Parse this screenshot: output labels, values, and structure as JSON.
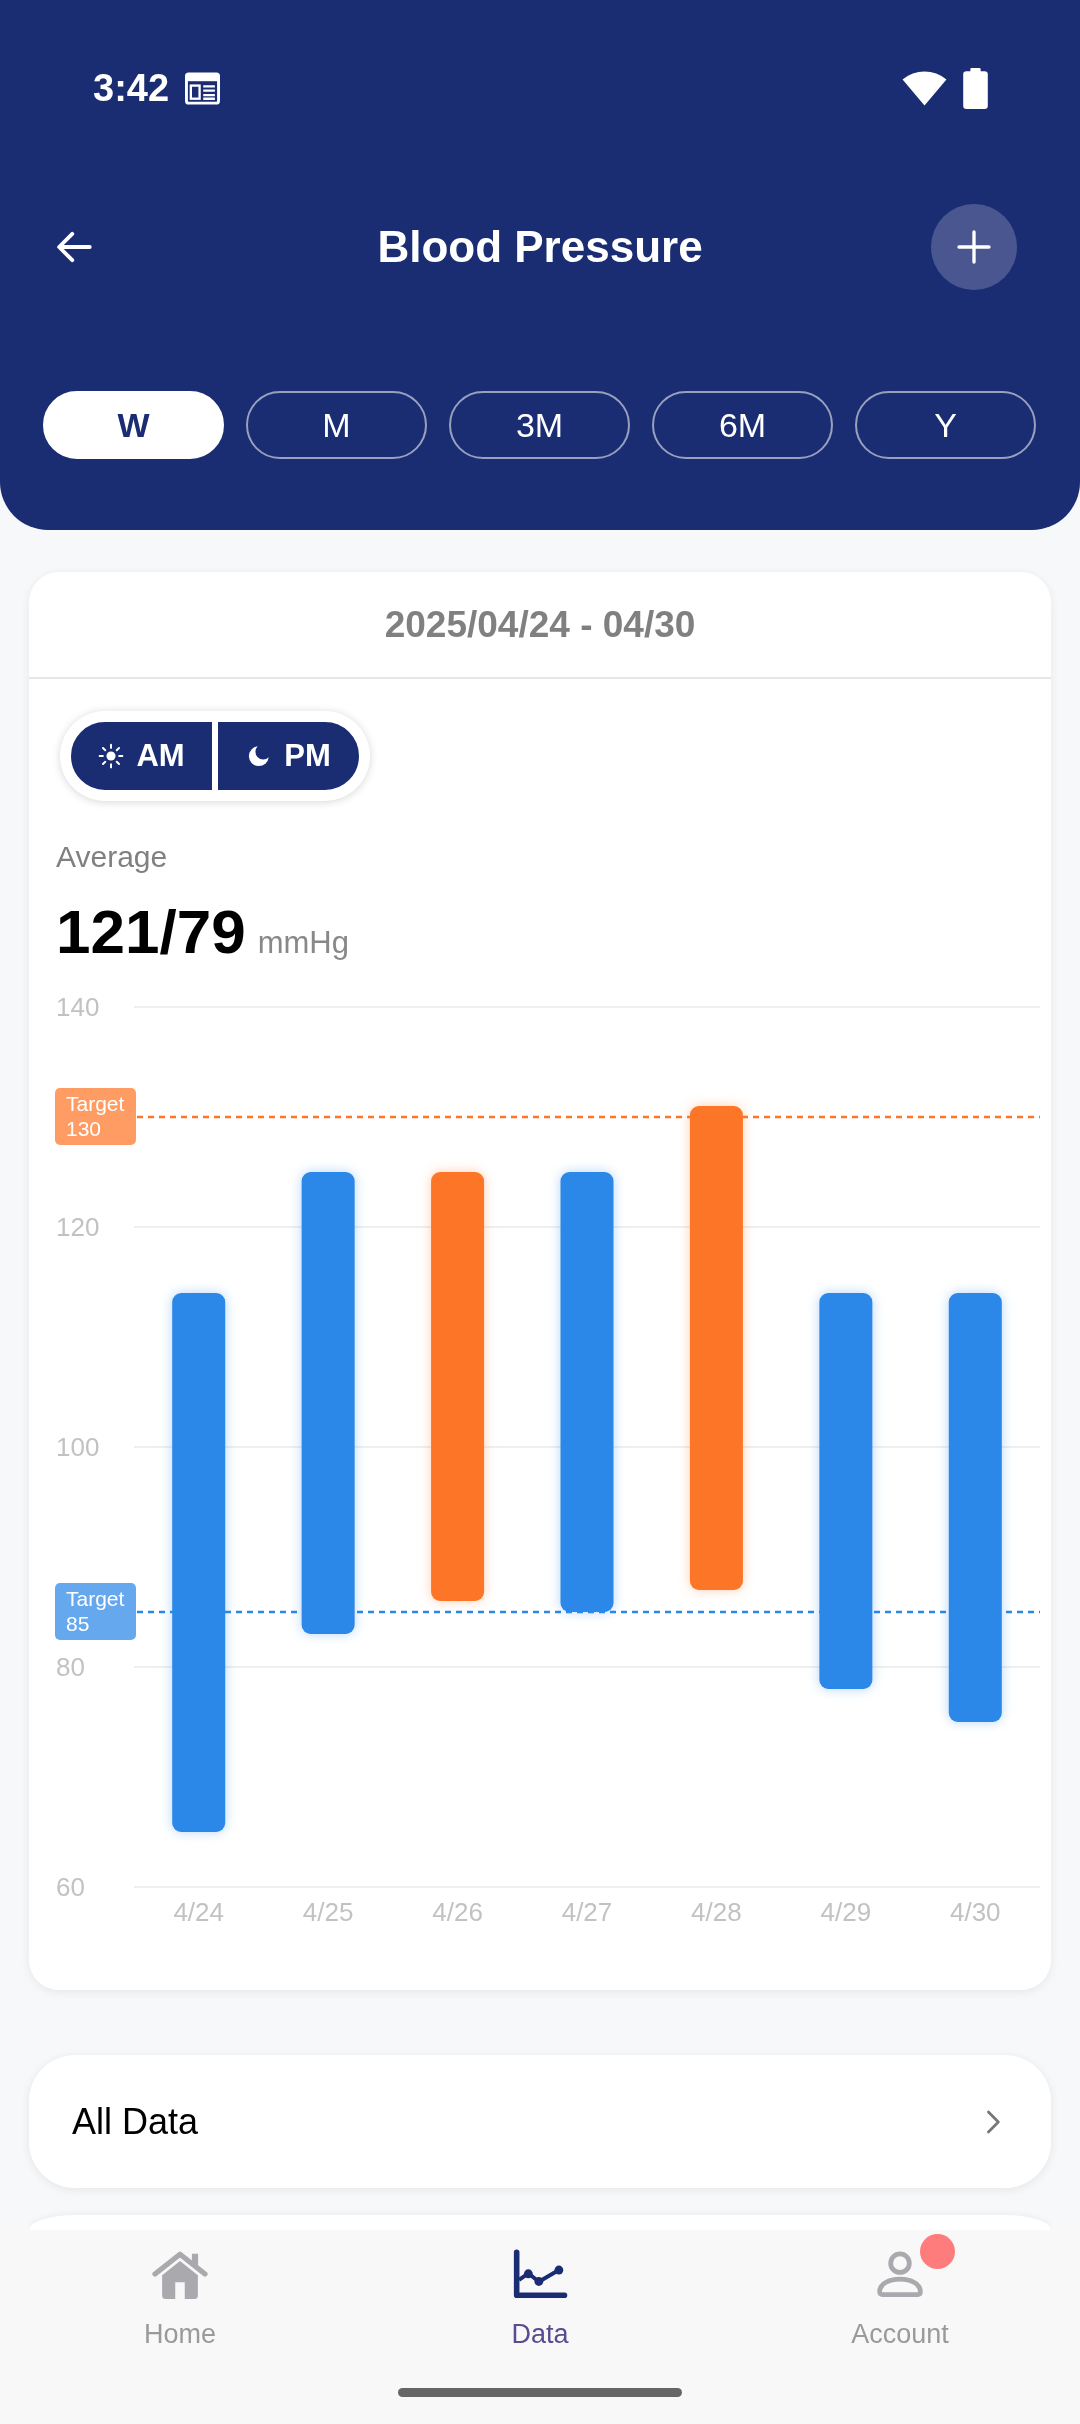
{
  "status_bar": {
    "time": "3:42"
  },
  "header": {
    "title": "Blood Pressure"
  },
  "range_tabs": [
    {
      "label": "W",
      "selected": true
    },
    {
      "label": "M",
      "selected": false
    },
    {
      "label": "3M",
      "selected": false
    },
    {
      "label": "6M",
      "selected": false
    },
    {
      "label": "Y",
      "selected": false
    }
  ],
  "summary_card": {
    "date_range": "2025/04/24 - 04/30",
    "session_toggle": [
      {
        "label": "AM",
        "on": true
      },
      {
        "label": "PM",
        "on": true
      }
    ],
    "average": {
      "label": "Average",
      "value": "121/79",
      "unit": "mmHg"
    },
    "chart_data": {
      "type": "candlestick",
      "categories": [
        "4/24",
        "4/25",
        "4/26",
        "4/27",
        "4/28",
        "4/29",
        "4/30"
      ],
      "series": [
        {
          "color": "#2b87e8",
          "ohlc": [
            [
              65,
              114,
              65,
              114
            ],
            [
              83,
              125,
              83,
              125
            ],
            null,
            [
              85,
              125,
              85,
              125
            ],
            null,
            [
              78,
              114,
              78,
              114
            ],
            [
              75,
              114,
              75,
              114
            ]
          ]
        },
        {
          "color": "#fd7628",
          "ohlc": [
            null,
            null,
            [
              86,
              125,
              86,
              125
            ],
            null,
            [
              87,
              131,
              87,
              131
            ],
            null,
            null
          ]
        }
      ],
      "ylim": [
        60,
        140
      ],
      "yticks": [
        60,
        80,
        100,
        120,
        140
      ],
      "grid": true,
      "ref_lines": [
        {
          "axis": "y",
          "value": 130,
          "label": "Target 130",
          "color": "#fd7628"
        },
        {
          "axis": "y",
          "value": 85,
          "label": "Target 85",
          "color": "#2b87e8"
        }
      ]
    }
  },
  "menu": [
    {
      "label": "All Data"
    }
  ],
  "bottom_nav": [
    {
      "label": "Home",
      "selected": false,
      "badge": false
    },
    {
      "label": "Data",
      "selected": true,
      "badge": false
    },
    {
      "label": "Account",
      "selected": false,
      "badge": true
    }
  ]
}
